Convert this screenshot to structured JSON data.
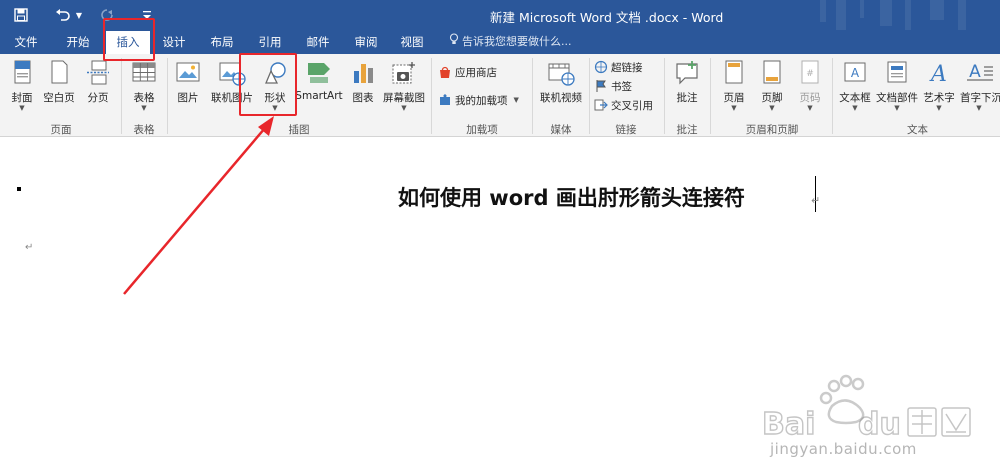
{
  "titlebar": {
    "title": "新建 Microsoft Word 文档 .docx - Word",
    "save_icon": "floppy-save-icon",
    "undo_icon": "undo-icon",
    "redo_icon": "redo-icon"
  },
  "tabs": [
    {
      "label": "文件"
    },
    {
      "label": "开始"
    },
    {
      "label": "插入"
    },
    {
      "label": "设计"
    },
    {
      "label": "布局"
    },
    {
      "label": "引用"
    },
    {
      "label": "邮件"
    },
    {
      "label": "审阅"
    },
    {
      "label": "视图"
    }
  ],
  "tell_me": "告诉我您想要做什么...",
  "ribbon": {
    "groups": {
      "pages": "页面",
      "tables": "表格",
      "illustrations": "插图",
      "addins": "加载项",
      "media": "媒体",
      "links": "链接",
      "comments": "批注",
      "header_footer": "页眉和页脚",
      "text": "文本"
    },
    "buttons": {
      "cover": "封面",
      "blank_page": "空白页",
      "page_break": "分页",
      "table": "表格",
      "pictures": "图片",
      "online_pictures": "联机图片",
      "shapes": "形状",
      "smartart": "SmartArt",
      "chart": "图表",
      "screenshot": "屏幕截图",
      "store": "应用商店",
      "my_addins": "我的加载项",
      "online_video": "联机视频",
      "hyperlink": "超链接",
      "bookmark": "书签",
      "cross_ref": "交叉引用",
      "comment": "批注",
      "header": "页眉",
      "footer": "页脚",
      "page_number": "页码",
      "textbox": "文本框",
      "quick_parts": "文档部件",
      "wordart": "艺术字",
      "dropcap": "首字下沉"
    }
  },
  "document": {
    "heading": "如何使用 word 画出肘形箭头连接符",
    "para_mark": "↵"
  },
  "watermark": {
    "url_text": "jingyan.baidu.com"
  },
  "colors": {
    "brand_blue": "#2b579a",
    "annotation_red": "#e8262b"
  }
}
